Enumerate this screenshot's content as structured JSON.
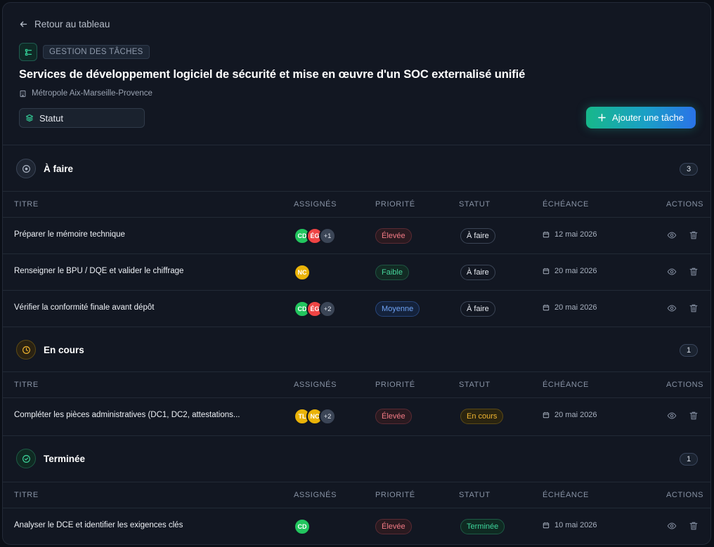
{
  "back": {
    "label": "Retour au tableau"
  },
  "module": {
    "tag": "GESTION DES TÂCHES"
  },
  "page": {
    "title": "Services de développement logiciel de sécurité et mise en œuvre d'un SOC externalisé unifié",
    "organization": "Métropole Aix-Marseille-Provence"
  },
  "filter": {
    "label": "Statut"
  },
  "add_task": {
    "label": "Ajouter une tâche"
  },
  "columns": {
    "title": "TITRE",
    "assignees": "ASSIGNÉS",
    "priority": "PRIORITÉ",
    "status": "STATUT",
    "due": "ÉCHÉANCE",
    "actions": "ACTIONS"
  },
  "sections": [
    {
      "title": "À faire",
      "count": "3",
      "rows": [
        {
          "title": "Préparer le mémoire technique",
          "avatars": [
            "CD",
            "ÉG"
          ],
          "more": "+1",
          "priority": "Élevée",
          "status": "À faire",
          "due": "12 mai 2026"
        },
        {
          "title": "Renseigner le BPU / DQE et valider le chiffrage",
          "avatars": [
            "NC"
          ],
          "more": "",
          "priority": "Faible",
          "status": "À faire",
          "due": "20 mai 2026"
        },
        {
          "title": "Vérifier la conformité finale avant dépôt",
          "avatars": [
            "CD",
            "ÉG"
          ],
          "more": "+2",
          "priority": "Moyenne",
          "status": "À faire",
          "due": "20 mai 2026"
        }
      ]
    },
    {
      "title": "En cours",
      "count": "1",
      "rows": [
        {
          "title": "Compléter les pièces administratives (DC1, DC2, attestations...",
          "avatars": [
            "TL",
            "NC"
          ],
          "more": "+2",
          "priority": "Élevée",
          "status": "En cours",
          "due": "20 mai 2026"
        }
      ]
    },
    {
      "title": "Terminée",
      "count": "1",
      "rows": [
        {
          "title": "Analyser le DCE et identifier les exigences clés",
          "avatars": [
            "CD"
          ],
          "more": "",
          "priority": "Élevée",
          "status": "Terminée",
          "due": "10 mai 2026"
        }
      ]
    }
  ],
  "colors": {
    "accent_green": "#22c55e",
    "accent_blue": "#2a73e8",
    "priority_high": "#f27a85",
    "priority_low": "#46d39a",
    "priority_medium": "#6fa3f5",
    "status_in_progress": "#f0b530",
    "status_done": "#3dd49b"
  },
  "icons": [
    "arrow-left-icon",
    "tasks-icon",
    "building-icon",
    "layers-icon",
    "plus-icon",
    "circle-dot-icon",
    "clock-icon",
    "check-circle-icon",
    "calendar-icon",
    "eye-icon",
    "trash-icon"
  ]
}
